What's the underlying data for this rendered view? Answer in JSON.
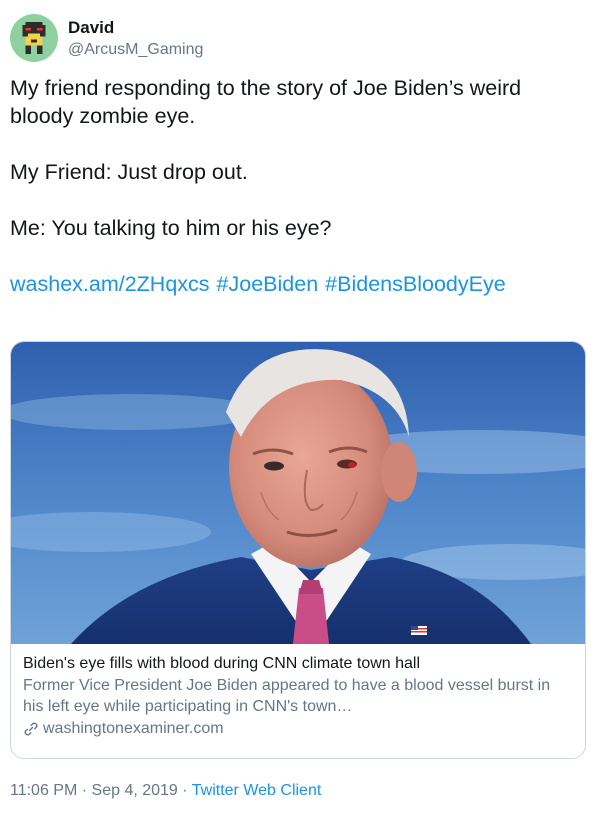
{
  "user": {
    "display_name": "David",
    "handle": "@ArcusM_Gaming",
    "avatar_icon": "pixel-robot-avatar"
  },
  "tweet": {
    "paragraphs": [
      "My friend responding to the story of Joe Biden’s weird bloody zombie eye.",
      "My Friend: Just drop out.",
      "Me: You talking to him or his eye?"
    ],
    "link": "washex.am/2ZHqxcs",
    "hashtags": [
      "#JoeBiden",
      "#BidensBloodyEye"
    ]
  },
  "card": {
    "title": "Biden's eye fills with blood during CNN climate town hall",
    "description": "Former Vice President Joe Biden appeared to have a blood vessel burst in his left eye while participating in CNN's town…",
    "domain": "washingtonexaminer.com",
    "domain_icon": "link-icon"
  },
  "meta": {
    "time": "11:06 PM",
    "separator": "·",
    "date": "Sep 4, 2019",
    "client": "Twitter Web Client"
  },
  "colors": {
    "link": "#1b95e0",
    "secondary_text": "#657786",
    "border": "#ccd6dd",
    "avatar_bg": "#8fd19e"
  }
}
